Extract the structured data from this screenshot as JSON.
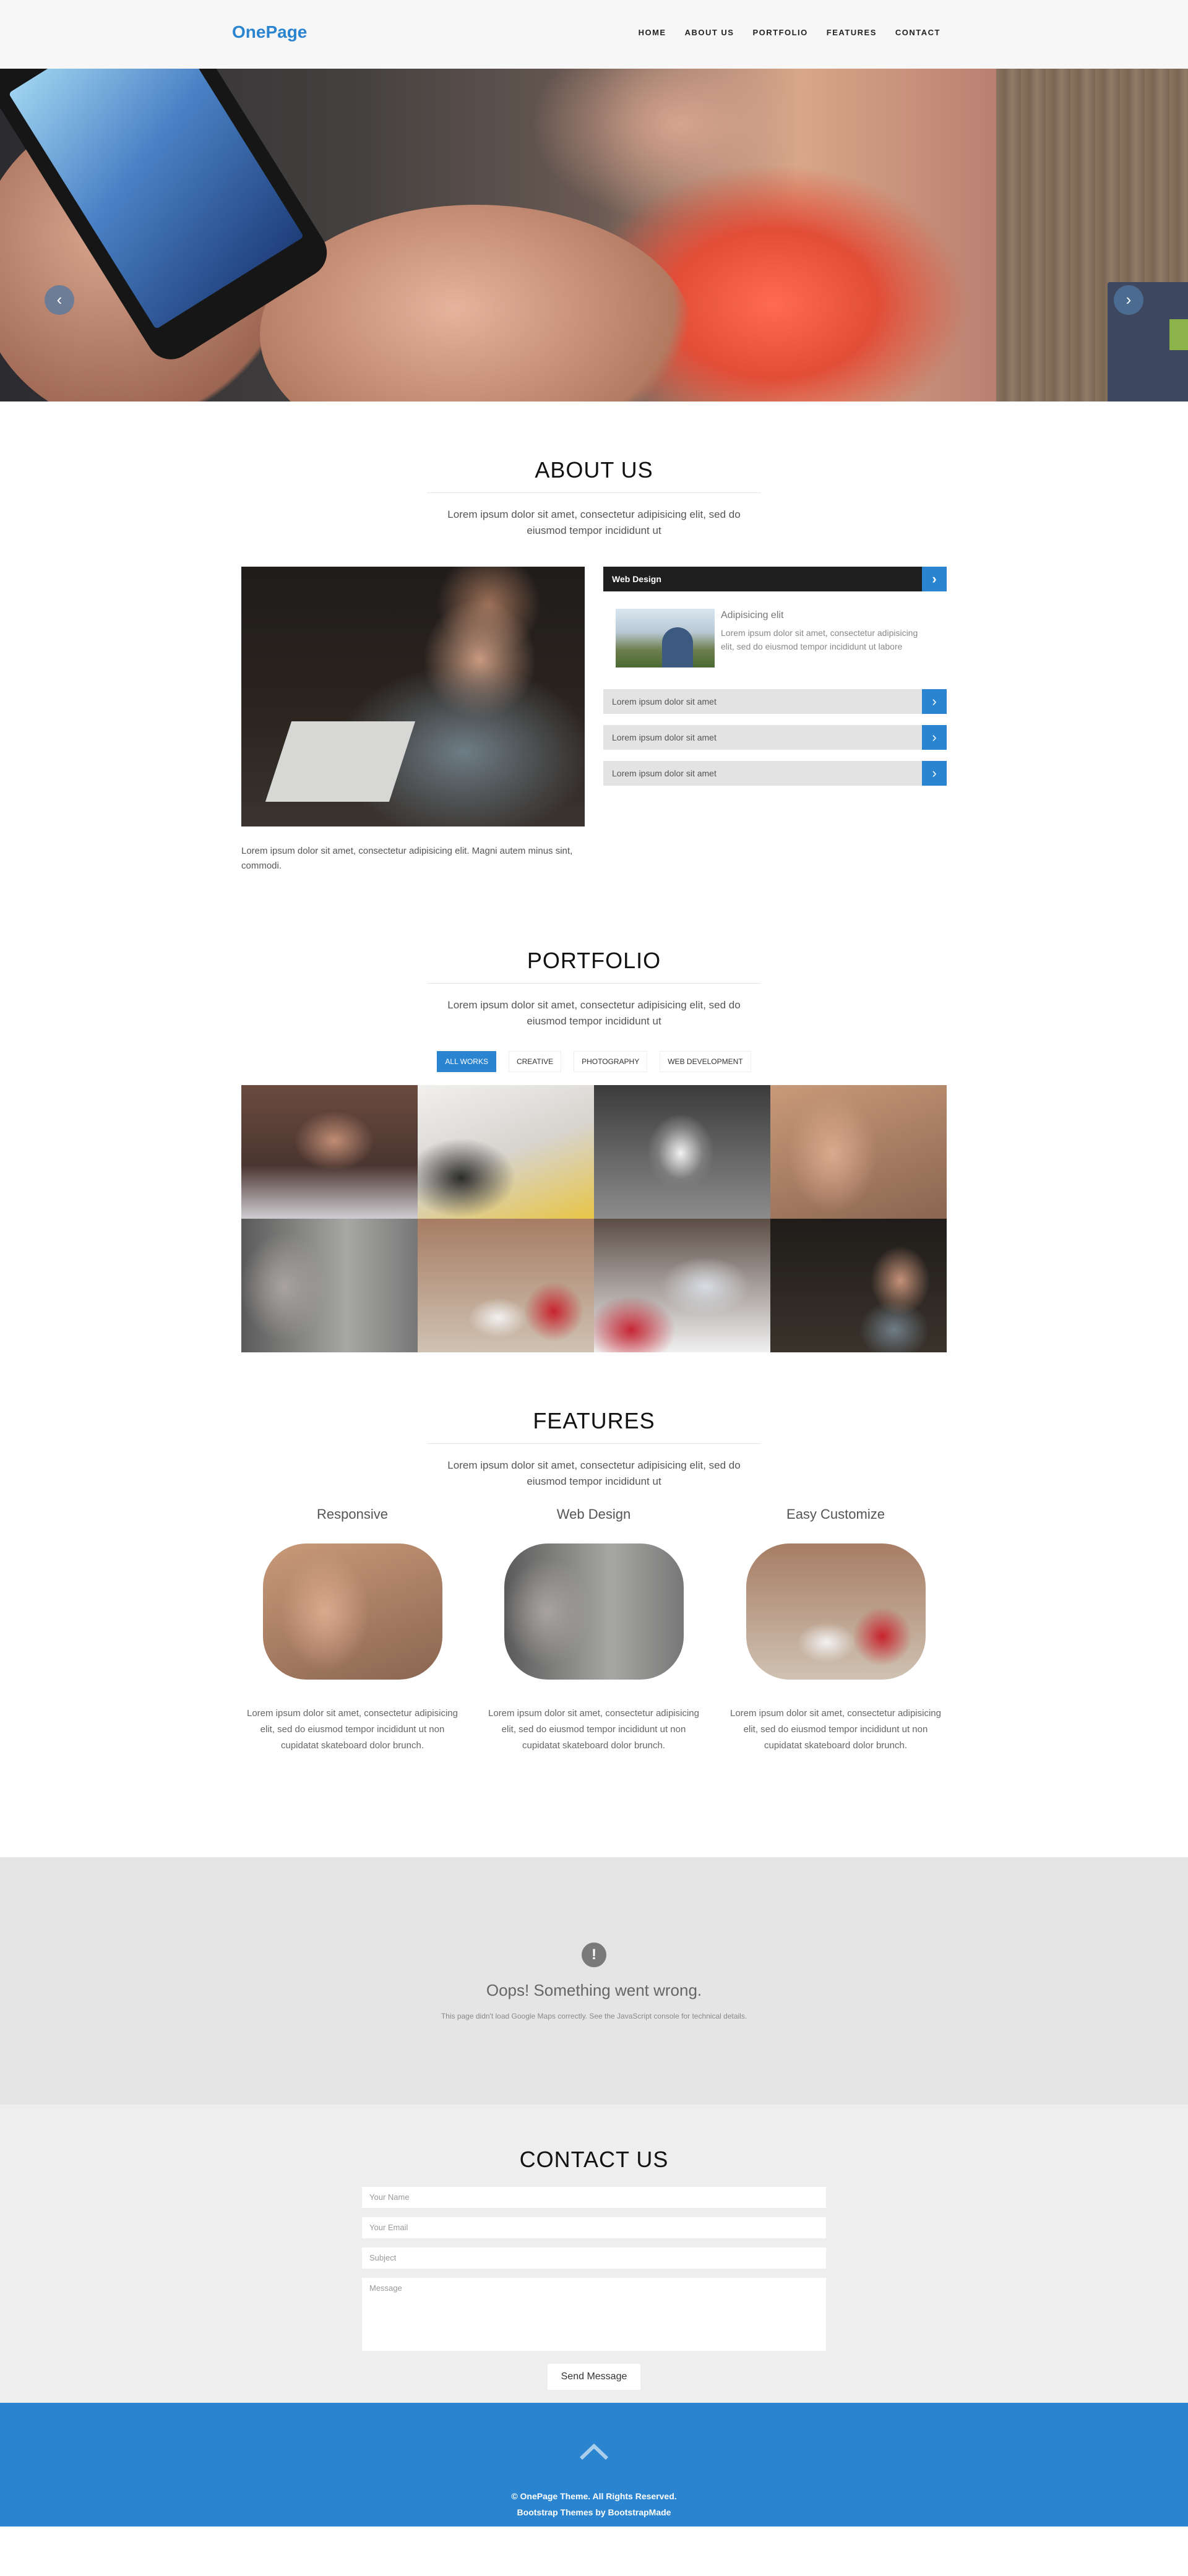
{
  "navbar": {
    "brand": "OnePage",
    "items": [
      {
        "label": "HOME"
      },
      {
        "label": "ABOUT US"
      },
      {
        "label": "PORTFOLIO"
      },
      {
        "label": "FEATURES"
      },
      {
        "label": "CONTACT"
      }
    ]
  },
  "hero": {
    "prev_icon": "chevron-left-icon",
    "next_icon": "chevron-right-icon"
  },
  "about": {
    "title": "ABOUT US",
    "subtitle": "Lorem ipsum dolor sit amet, consectetur adipisicing elit, sed do eiusmod tempor incididunt ut",
    "text": "Lorem ipsum dolor sit amet, consectetur adipisicing elit. Magni autem minus sint, commodi.",
    "accordion": {
      "active_title": "Web Design",
      "item_title": "Adipisicing elit",
      "item_desc": "Lorem ipsum dolor sit amet, consectetur adipisicing elit, sed do eiusmod tempor incididunt ut labore",
      "items": [
        {
          "label": "Lorem ipsum dolor sit amet"
        },
        {
          "label": "Lorem ipsum dolor sit amet"
        },
        {
          "label": "Lorem ipsum dolor sit amet"
        }
      ]
    }
  },
  "portfolio": {
    "title": "PORTFOLIO",
    "subtitle": "Lorem ipsum dolor sit amet, consectetur adipisicing elit, sed do eiusmod tempor incididunt ut",
    "filters": [
      {
        "label": "ALL WORKS",
        "active": true
      },
      {
        "label": "CREATIVE",
        "active": false
      },
      {
        "label": "PHOTOGRAPHY",
        "active": false
      },
      {
        "label": "WEB DEVELOPMENT",
        "active": false
      }
    ]
  },
  "features": {
    "title": "FEATURES",
    "subtitle": "Lorem ipsum dolor sit amet, consectetur adipisicing elit, sed do eiusmod tempor incididunt ut",
    "items": [
      {
        "title": "Responsive",
        "text": "Lorem ipsum dolor sit amet, consectetur adipisicing elit, sed do eiusmod tempor incididunt ut non cupidatat skateboard dolor brunch."
      },
      {
        "title": "Web Design",
        "text": "Lorem ipsum dolor sit amet, consectetur adipisicing elit, sed do eiusmod tempor incididunt ut non cupidatat skateboard dolor brunch."
      },
      {
        "title": "Easy Customize",
        "text": "Lorem ipsum dolor sit amet, consectetur adipisicing elit, sed do eiusmod tempor incididunt ut non cupidatat skateboard dolor brunch."
      }
    ]
  },
  "map": {
    "icon": "!",
    "title": "Oops! Something went wrong.",
    "desc": "This page didn't load Google Maps correctly. See the JavaScript console for technical details."
  },
  "contact": {
    "title": "CONTACT US",
    "name_placeholder": "Your Name",
    "email_placeholder": "Your Email",
    "subject_placeholder": "Subject",
    "message_placeholder": "Message",
    "send_label": "Send Message"
  },
  "footer": {
    "copyright": "© OnePage Theme. All Rights Reserved.",
    "credit": "Bootstrap Themes by BootstrapMade"
  },
  "colors": {
    "accent": "#2a84d0",
    "dark": "#1f1f1f"
  }
}
